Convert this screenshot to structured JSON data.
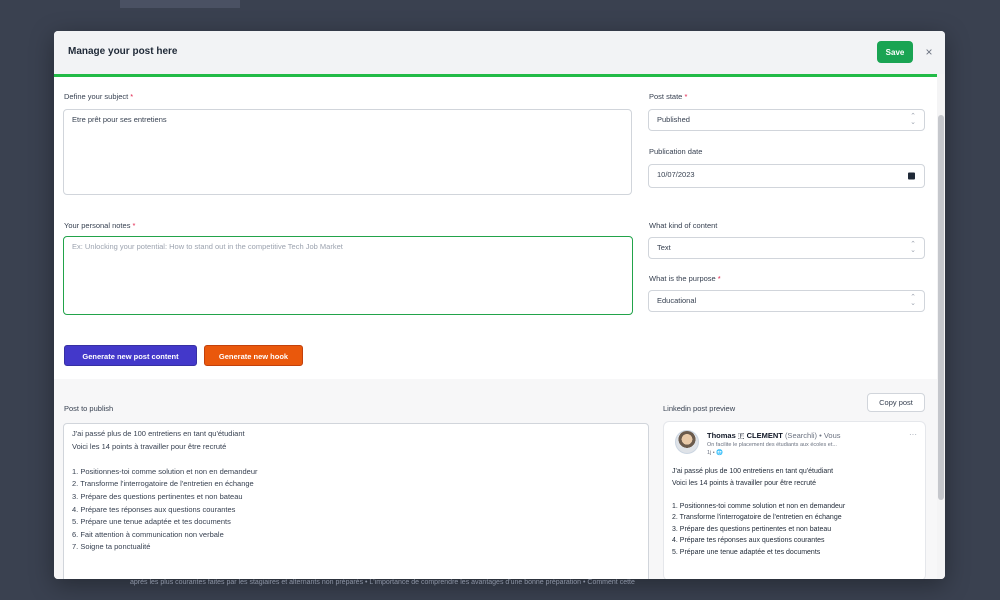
{
  "background": {
    "footer_text": "après les plus courantes faites par les stagiaires et alternants non préparés • L'importance de comprendre les avantages d'une bonne préparation • Comment cette"
  },
  "modal": {
    "title": "Manage your post here",
    "save_label": "Save",
    "close_glyph": "×",
    "accent_color": "#22bb47"
  },
  "form": {
    "subject": {
      "label": "Define your subject",
      "required": "*",
      "value": "Etre prêt pour ses entretiens"
    },
    "notes": {
      "label": "Your personal notes",
      "required": "*",
      "placeholder": "Ex: Unlocking your potential: How to stand out in the competitive Tech Job Market"
    },
    "post_state": {
      "label": "Post state",
      "required": "*",
      "value": "Published"
    },
    "publication_date": {
      "label": "Publication date",
      "value": "10/07/2023"
    },
    "content_kind": {
      "label": "What kind of content",
      "value": "Text"
    },
    "purpose": {
      "label": "What is the purpose",
      "required": "*",
      "value": "Educational"
    },
    "generate_content_label": "Generate new post content",
    "generate_hook_label": "Generate new hook"
  },
  "post": {
    "label": "Post to publish",
    "lines": [
      "J'ai passé plus de 100 entretiens en tant qu'étudiant",
      "Voici les 14 points à travailler pour être recruté",
      "",
      "1. Positionnes-toi comme solution et non en demandeur",
      "2. Transforme l'interrogatoire de l'entretien en échange",
      "3. Prépare des questions pertinentes et non bateau",
      "4. Prépare tes réponses aux questions courantes",
      "5. Prépare une tenue adaptée et tes documents",
      "6. Fait attention à communication non verbale",
      "7. Soigne ta ponctualité"
    ]
  },
  "preview": {
    "label": "Linkedin post preview",
    "copy_label": "Copy post",
    "author_first": "Thomas",
    "author_flag": "🇫",
    "author_last": "CLEMENT",
    "author_suffix": "(Searchli) • Vous",
    "tagline": "On facilite le placement des étudiants aux écoles et...",
    "meta": "1j • 🌐",
    "more": "···",
    "lines": [
      "J'ai passé plus de 100 entretiens en tant qu'étudiant",
      "Voici les 14 points à travailler pour être recruté",
      "",
      "1. Positionnes-toi comme solution et non en demandeur",
      "2. Transforme l'interrogatoire de l'entretien en échange",
      "3. Prépare des questions pertinentes et non bateau",
      "4. Prépare tes réponses aux questions courantes",
      "5. Prépare une tenue adaptée et tes documents"
    ]
  }
}
